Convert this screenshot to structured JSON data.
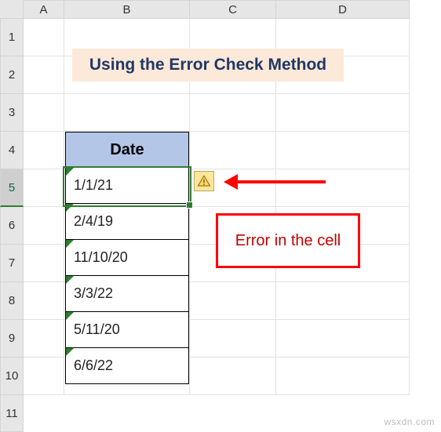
{
  "columns": [
    "A",
    "B",
    "C",
    "D"
  ],
  "rows": [
    "1",
    "2",
    "3",
    "4",
    "5",
    "6",
    "7",
    "8",
    "9",
    "10",
    "11"
  ],
  "selected_row": "5",
  "title": "Using the Error Check Method",
  "table": {
    "header": "Date",
    "values": [
      "1/1/21",
      "2/4/19",
      "11/10/20",
      "3/3/22",
      "5/11/20",
      "6/6/22"
    ]
  },
  "error_icon": "warning-triangle",
  "callout_text": "Error in the cell",
  "watermark": "wsxdn.com",
  "chart_data": {
    "type": "table",
    "title": "Date",
    "categories": [
      "B5",
      "B6",
      "B7",
      "B8",
      "B9",
      "B10"
    ],
    "values": [
      "1/1/21",
      "2/4/19",
      "11/10/20",
      "3/3/22",
      "5/11/20",
      "6/6/22"
    ]
  }
}
